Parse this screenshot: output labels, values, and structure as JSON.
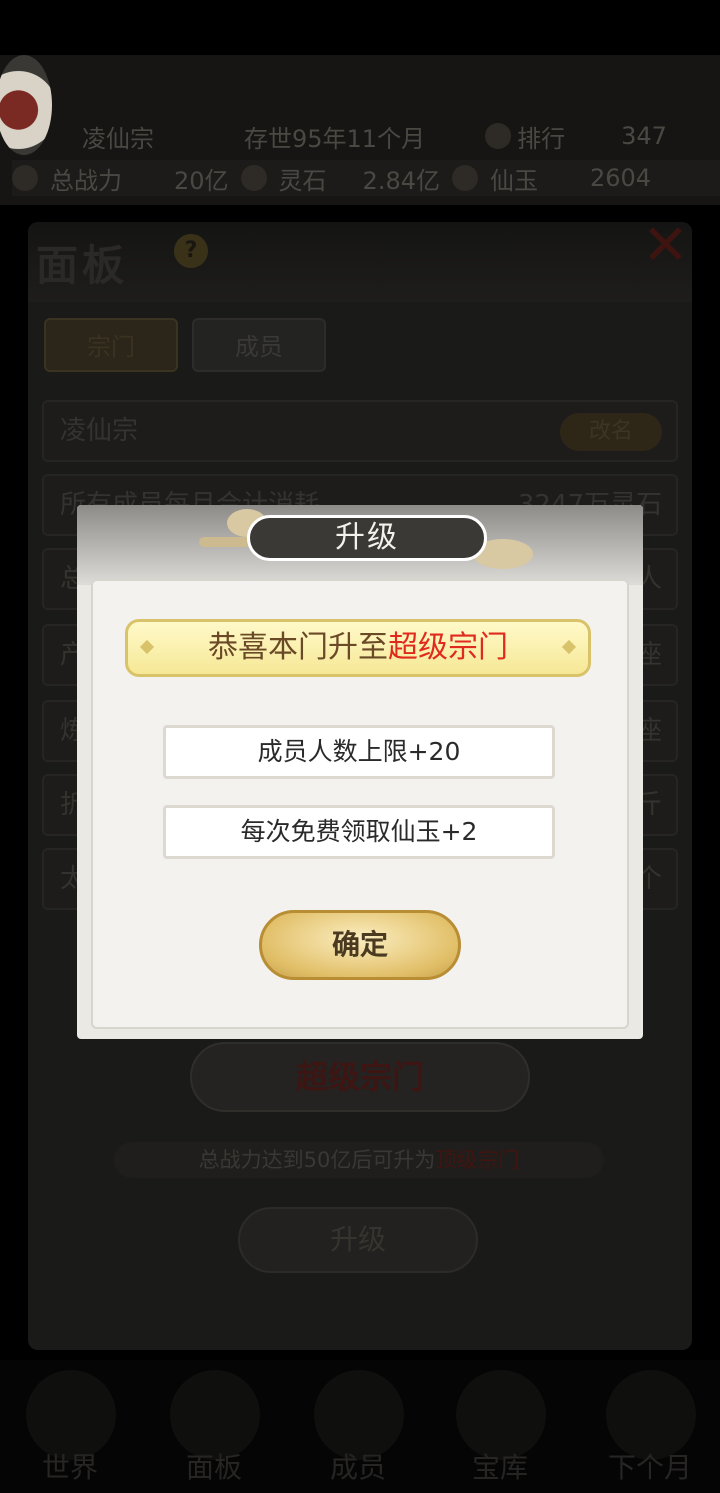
{
  "header": {
    "sect_name": "凌仙宗",
    "age": "存世95年11个月",
    "rank_label": "排行",
    "rank_value": "347",
    "power_label": "总战力",
    "power_value": "20亿",
    "spirit_label": "灵石",
    "spirit_value": "2.84亿",
    "jade_label": "仙玉",
    "jade_value": "2604"
  },
  "panel": {
    "title": "面板",
    "help": "?",
    "tabs": [
      "宗门",
      "成员"
    ],
    "sect_name": "凌仙宗",
    "rename_label": "改名",
    "rows": [
      {
        "left": "所有成员每月合计消耗",
        "right": "3247万灵石"
      },
      {
        "left": "总",
        "right": "人"
      },
      {
        "left": "产",
        "right": "座"
      },
      {
        "left": "炼",
        "right": "座"
      },
      {
        "left": "折",
        "right": "斤"
      },
      {
        "left": "太",
        "right": "个"
      }
    ],
    "sect_level": "超级宗门",
    "hint_prefix": "总战力达到50亿后可升为",
    "hint_target": "顶级宗门",
    "upgrade_label": "升级"
  },
  "nav": {
    "items": [
      "世界",
      "面板",
      "成员",
      "宝库",
      "下个月"
    ]
  },
  "modal": {
    "title": "升级",
    "congrats_prefix": "恭喜本门升至",
    "congrats_level": "超级宗门",
    "rewards": [
      "成员人数上限+20",
      "每次免费领取仙玉+2"
    ],
    "confirm_label": "确定"
  },
  "colors": {
    "highlight_red": "#e02a1e",
    "gold": "#e2c06a"
  }
}
